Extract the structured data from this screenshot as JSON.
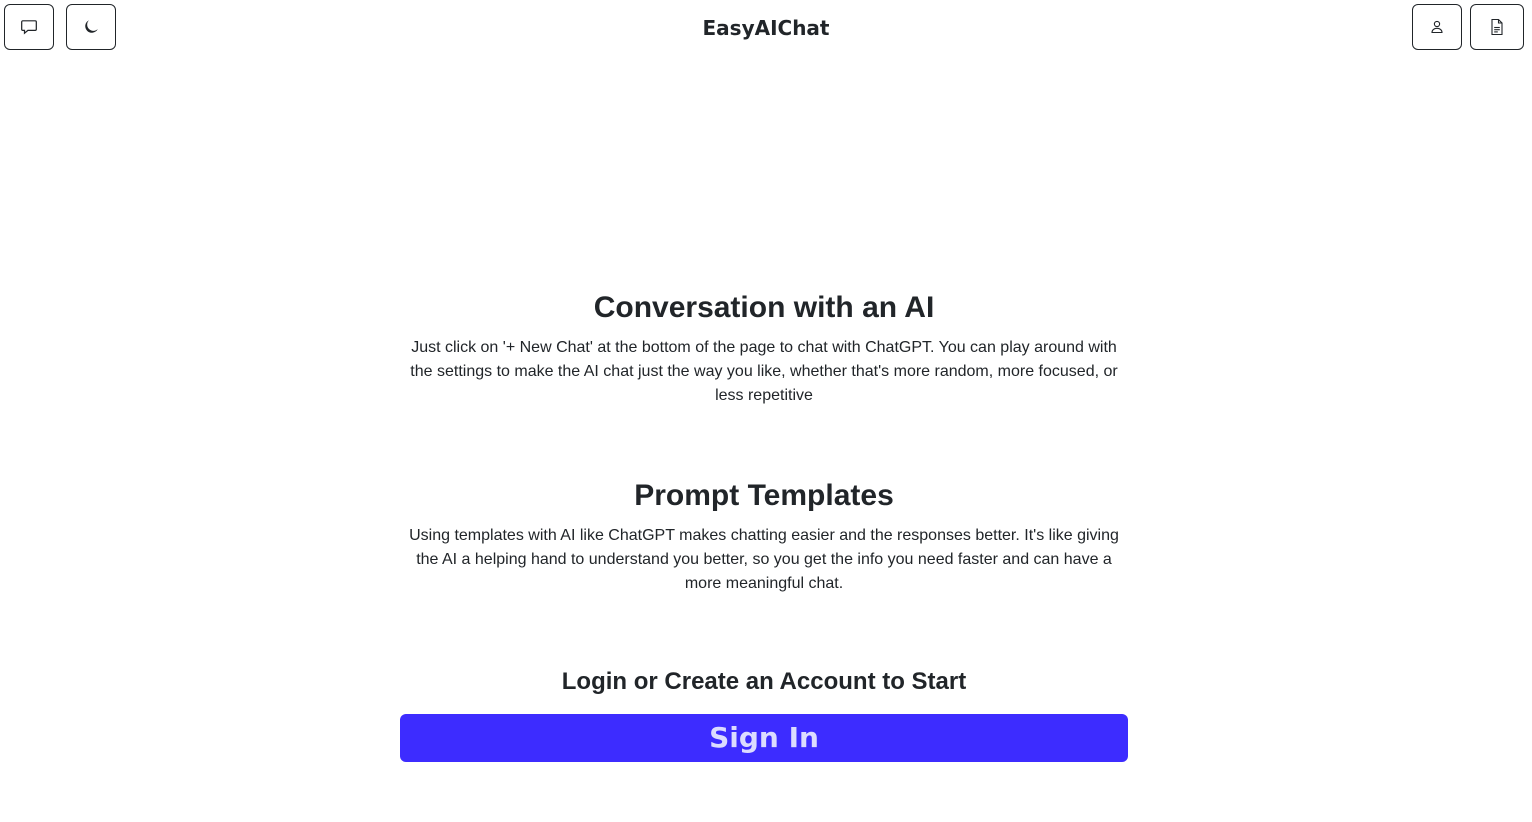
{
  "header": {
    "title": "EasyAIChat",
    "left_buttons": [
      {
        "icon": "chat-bubble-icon"
      },
      {
        "icon": "moon-icon"
      }
    ],
    "right_buttons": [
      {
        "icon": "user-icon"
      },
      {
        "icon": "document-icon"
      }
    ]
  },
  "sections": [
    {
      "heading": "Conversation with an AI",
      "body": "Just click on '+ New Chat' at the bottom of the page to chat with ChatGPT. You can play around with the settings to make the AI chat just the way you like, whether that's more random, more focused, or less repetitive"
    },
    {
      "heading": "Prompt Templates",
      "body": "Using templates with AI like ChatGPT makes chatting easier and the responses better. It's like giving the AI a helping hand to understand you better, so you get the info you need faster and can have a more meaningful chat."
    }
  ],
  "login": {
    "prompt": "Login or Create an Account to Start",
    "button_label": "Sign In"
  },
  "colors": {
    "accent": "#3d2cff",
    "text": "#212529",
    "background": "#ffffff"
  }
}
